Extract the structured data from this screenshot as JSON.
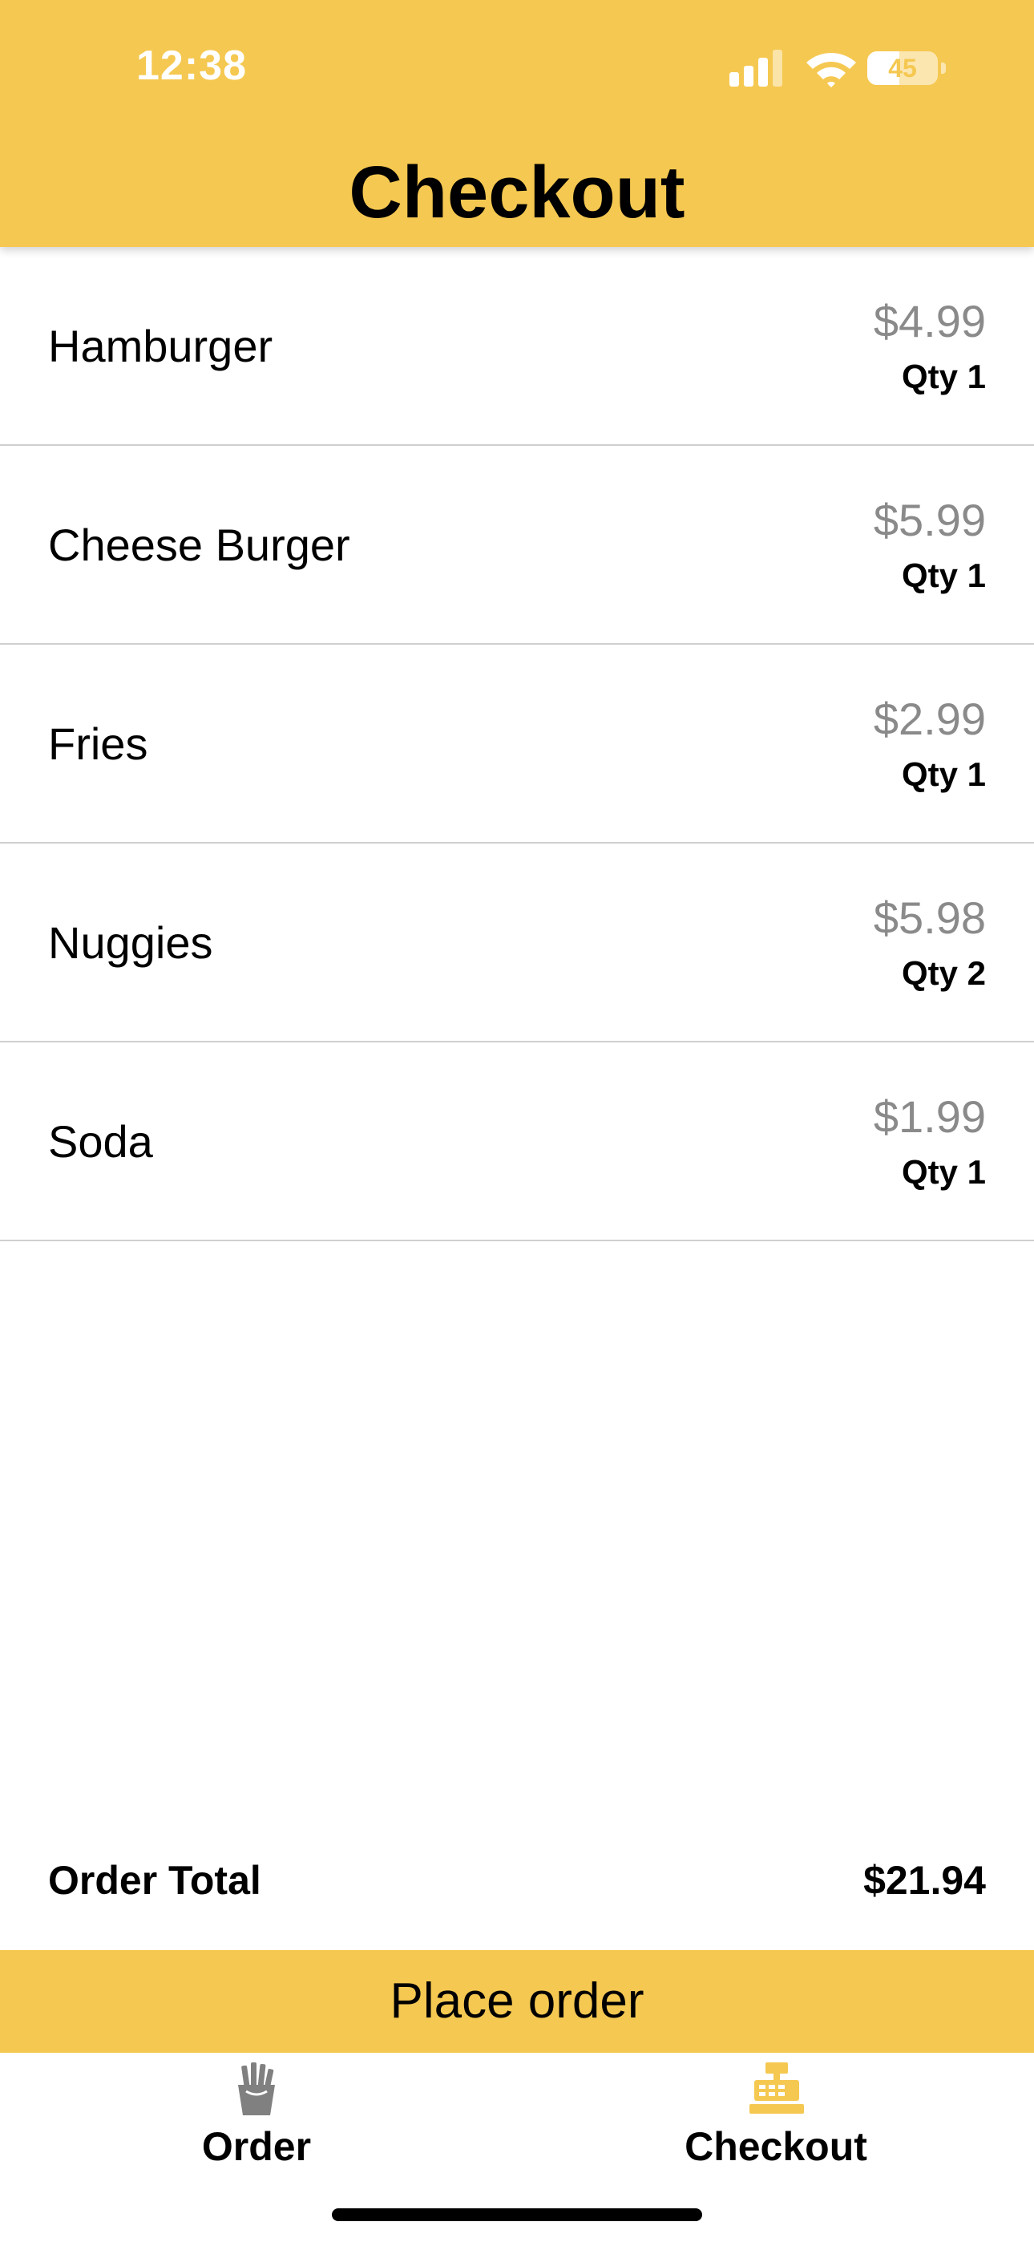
{
  "status_bar": {
    "time": "12:38",
    "battery_level": "45",
    "battery_fraction": 0.45
  },
  "header": {
    "title": "Checkout",
    "background_color": "#f5c851"
  },
  "items": [
    {
      "name": "Hamburger",
      "price": "$4.99",
      "qty": "Qty 1"
    },
    {
      "name": "Cheese Burger",
      "price": "$5.99",
      "qty": "Qty 1"
    },
    {
      "name": "Fries",
      "price": "$2.99",
      "qty": "Qty 1"
    },
    {
      "name": "Nuggies",
      "price": "$5.98",
      "qty": "Qty 2"
    },
    {
      "name": "Soda",
      "price": "$1.99",
      "qty": "Qty 1"
    }
  ],
  "summary": {
    "total_label": "Order Total",
    "total_value": "$21.94"
  },
  "place_order_label": "Place order",
  "tabs": [
    {
      "label": "Order",
      "icon": "fries-icon",
      "active": false,
      "color": "#808080"
    },
    {
      "label": "Checkout",
      "icon": "cash-register-icon",
      "active": true,
      "color": "#f5c851"
    }
  ]
}
